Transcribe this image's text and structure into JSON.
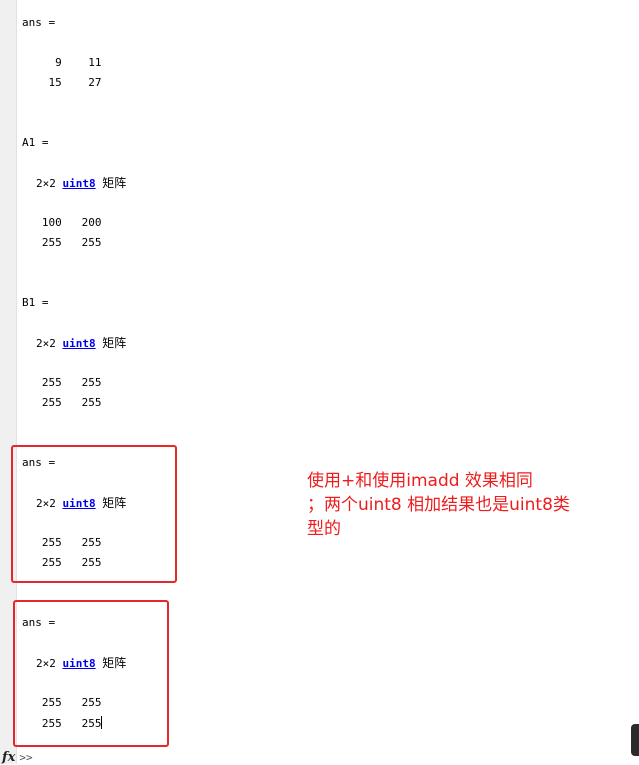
{
  "blocks": [
    {
      "header": "ans =",
      "rows": [
        "     9    11",
        "    15    27"
      ]
    },
    {
      "header": "A1 =",
      "size": "2×2",
      "type": "uint8",
      "kind": "矩阵",
      "rows": [
        "   100   200",
        "   255   255"
      ]
    },
    {
      "header": "B1 =",
      "size": "2×2",
      "type": "uint8",
      "kind": "矩阵",
      "rows": [
        "   255   255",
        "   255   255"
      ]
    },
    {
      "header": "ans =",
      "size": "2×2",
      "type": "uint8",
      "kind": "矩阵",
      "rows": [
        "   255   255",
        "   255   255"
      ]
    },
    {
      "header": "ans =",
      "size": "2×2",
      "type": "uint8",
      "kind": "矩阵",
      "rows": [
        "   255   255",
        "   255   255"
      ]
    }
  ],
  "annotation": {
    "line1": "使用+和使用imadd 效果相同",
    "line2": "；两个uint8 相加结果也是uint8类",
    "line3": "型的",
    "color": "#ee1c1c"
  },
  "prompt": {
    "fx": "fx",
    "arrows": ">>"
  }
}
